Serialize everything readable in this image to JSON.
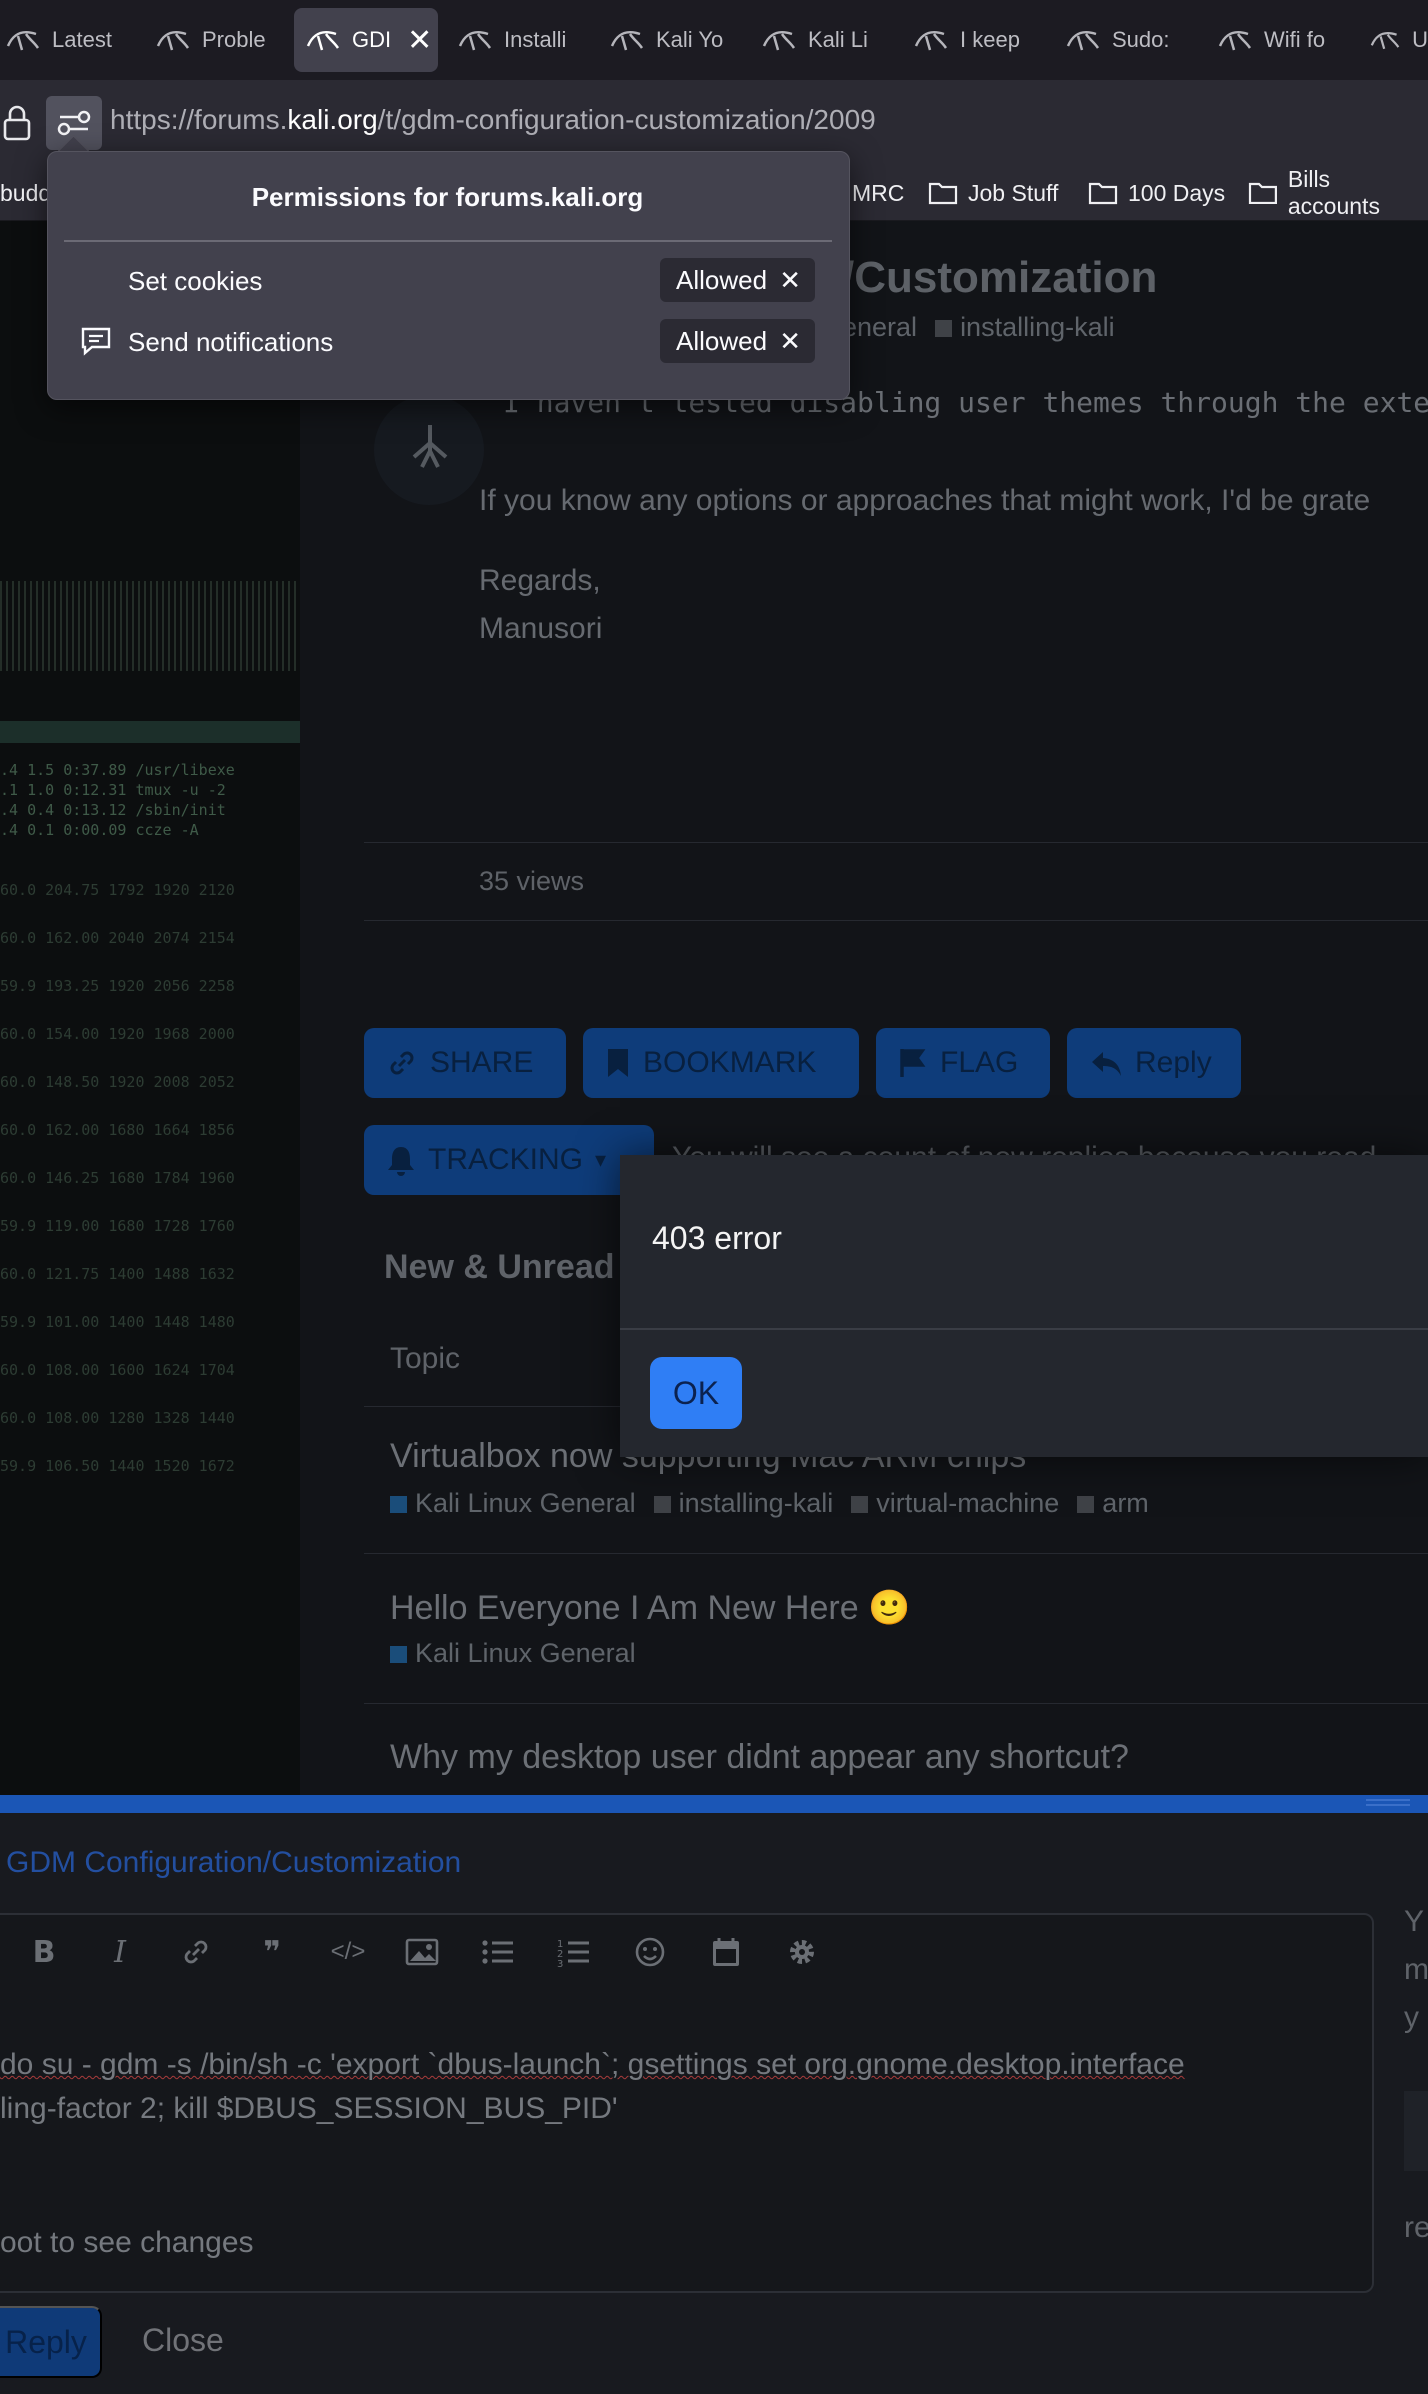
{
  "tabs": [
    {
      "label": "Latest"
    },
    {
      "label": "Proble"
    },
    {
      "label": "GDI"
    },
    {
      "label": "Installi"
    },
    {
      "label": "Kali Yo"
    },
    {
      "label": "Kali Li"
    },
    {
      "label": "I keep"
    },
    {
      "label": "Sudo:"
    },
    {
      "label": "Wifi fo"
    },
    {
      "label": "U"
    }
  ],
  "url": {
    "prefix": "https://forums.",
    "domain": "kali.org",
    "path": "/t/gdm-configuration-customization/2009"
  },
  "bookmarks": [
    {
      "label": "budd"
    },
    {
      "label": "MRC"
    },
    {
      "label": "Job Stuff"
    },
    {
      "label": "100 Days"
    },
    {
      "label": "Bills accounts"
    }
  ],
  "permissions": {
    "title": "Permissions for forums.kali.org",
    "items": [
      {
        "label": "Set cookies",
        "state": "Allowed"
      },
      {
        "label": "Send notifications",
        "state": "Allowed"
      }
    ]
  },
  "topic": {
    "title_fragment": "/Customization",
    "tags": [
      "eneral",
      "installing-kali"
    ],
    "code_line": "I haven't tested disabling user themes through the exte",
    "body": "If you know any options or approaches that might work, I'd be grate",
    "regards": "Regards,",
    "signature": "Manusori",
    "views": "35 views"
  },
  "post_actions": {
    "share": "SHARE",
    "bookmark": "BOOKMARK",
    "flag": "FLAG",
    "reply": "Reply",
    "tracking": "TRACKING",
    "tracking_note": "You will see a count of new replies because you read"
  },
  "suggested": {
    "heading": "New & Unread",
    "col_topic": "Topic",
    "topics": [
      {
        "title": "Virtualbox now supporting Mac ARM chips",
        "category": "Kali Linux General",
        "tags": [
          "installing-kali",
          "virtual-machine",
          "arm"
        ]
      },
      {
        "title": "Hello Everyone I Am New Here",
        "emoji": "🙂",
        "category": "Kali Linux General",
        "tags": []
      },
      {
        "title": "Why my desktop user didnt appear any shortcut?",
        "category": "",
        "tags": []
      }
    ]
  },
  "dialog": {
    "message": "403 error",
    "ok": "OK"
  },
  "composer": {
    "title": "GDM Configuration/Customization",
    "line1": "do su - gdm -s /bin/sh -c 'export `dbus-launch`; gsettings set org.gnome.desktop.interface",
    "line2": "ling-factor 2; kill $DBUS_SESSION_BUS_PID'",
    "line3": "oot to see changes",
    "reply": "Reply",
    "close": "Close",
    "side_letters": [
      "Y",
      "m",
      "y",
      "re"
    ]
  },
  "colors": {
    "accent": "#2f7ef5",
    "composer_bar": "#1b56b6",
    "popup_bg": "#42414d"
  }
}
